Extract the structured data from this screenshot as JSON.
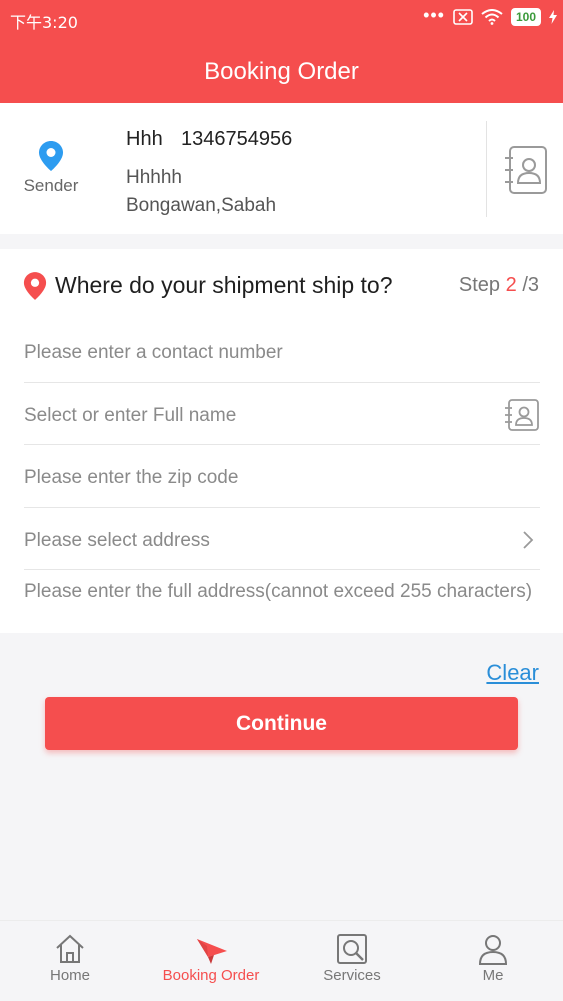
{
  "status_bar": {
    "time": "下午3:20",
    "dots": "•••",
    "battery": "100"
  },
  "header": {
    "title": "Booking Order"
  },
  "sender": {
    "label": "Sender",
    "name": "Hhh",
    "phone": "1346754956",
    "line2": "Hhhhh",
    "line3": "Bongawan,Sabah"
  },
  "recipient": {
    "question": "Where do your shipment ship to?",
    "step_prefix": "Step",
    "step_current": "2",
    "step_total": "/3",
    "contact_placeholder": "Please enter a contact number",
    "name_placeholder": "Select or enter Full name",
    "zip_placeholder": "Please enter the zip code",
    "address_placeholder": "Please select address",
    "full_address_placeholder": "Please enter the full address(cannot exceed 255 characters)"
  },
  "actions": {
    "clear": "Clear",
    "continue": "Continue"
  },
  "tabs": [
    {
      "label": "Home",
      "icon": "home-icon"
    },
    {
      "label": "Booking Order",
      "icon": "paper-plane-icon"
    },
    {
      "label": "Services",
      "icon": "search-doc-icon"
    },
    {
      "label": "Me",
      "icon": "user-icon"
    }
  ],
  "colors": {
    "brand_red": "#f54e4e",
    "link_blue": "#2a8ed8",
    "pin_blue": "#2d9cf0"
  }
}
